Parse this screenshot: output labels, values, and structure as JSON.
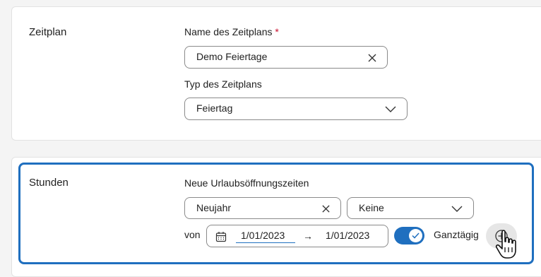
{
  "schedule": {
    "section_title": "Zeitplan",
    "name_label": "Name des Zeitplans",
    "required_mark": "*",
    "name_value": "Demo Feiertage",
    "type_label": "Typ des Zeitplans",
    "type_value": "Feiertag"
  },
  "hours": {
    "section_title": "Stunden",
    "new_label": "Neue Urlaubsöffnungszeiten",
    "holiday_value": "Neujahr",
    "repeat_value": "Keine",
    "from_label": "von",
    "start_date": "1/01/2023",
    "arrow": "→",
    "end_date": "1/01/2023",
    "all_day_label": "Ganztägig",
    "all_day_on": true
  },
  "colors": {
    "accent": "#1f6fbf",
    "required": "#c8102e"
  },
  "icons": [
    "close-icon",
    "chevron-down-icon",
    "calendar-icon",
    "check-icon",
    "add-icon",
    "hand-cursor-icon"
  ]
}
